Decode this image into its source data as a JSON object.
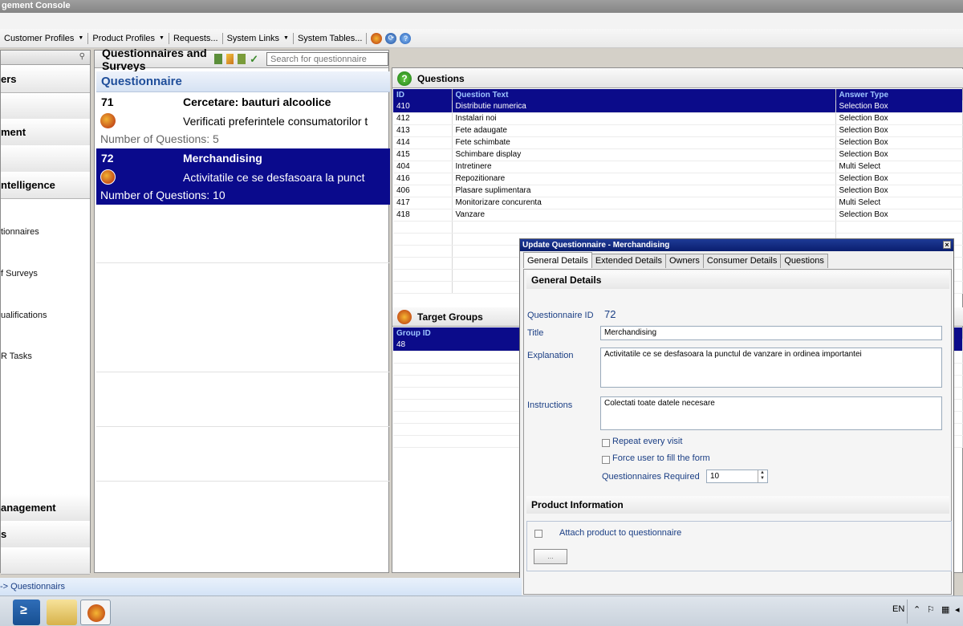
{
  "window": {
    "title": "gement Console"
  },
  "menu": {
    "items": [
      "Customer Profiles",
      "Product Profiles",
      "Requests...",
      "System Links",
      "System Tables..."
    ]
  },
  "left_nav": {
    "groups": [
      "ers",
      "ment",
      "ntelligence",
      "anagement",
      "s"
    ],
    "links": [
      "tionnaires",
      "f Surveys",
      "ualifications",
      "R Tasks"
    ]
  },
  "center": {
    "title": "Questionnaires and Surveys",
    "search_placeholder": "Search for questionnaire",
    "list_header": "Questionnaire",
    "items": [
      {
        "id": "71",
        "name": "Cercetare: bauturi alcoolice",
        "desc": "Verificati preferintele consumatorilor t",
        "count": "Number of Questions: 5"
      },
      {
        "id": "72",
        "name": "Merchandising",
        "desc": "Activitatile ce se desfasoara la punct",
        "count": "Number of Questions: 10"
      }
    ]
  },
  "questions": {
    "title": "Questions",
    "columns": [
      "ID",
      "Question Text",
      "Answer Type"
    ],
    "rows": [
      [
        "410",
        "Distributie numerica",
        "Selection Box"
      ],
      [
        "412",
        "Instalari noi",
        "Selection Box"
      ],
      [
        "413",
        "Fete adaugate",
        "Selection Box"
      ],
      [
        "414",
        "Fete schimbate",
        "Selection Box"
      ],
      [
        "415",
        "Schimbare display",
        "Selection Box"
      ],
      [
        "404",
        "Intretinere",
        "Multi Select"
      ],
      [
        "416",
        "Repozitionare",
        "Selection Box"
      ],
      [
        "406",
        "Plasare suplimentara",
        "Selection Box"
      ],
      [
        "417",
        "Monitorizare concurenta",
        "Multi Select"
      ],
      [
        "418",
        "Vanzare",
        "Selection Box"
      ]
    ]
  },
  "target_groups": {
    "title": "Target Groups",
    "columns": [
      "Group ID"
    ],
    "rows": [
      [
        "48"
      ]
    ]
  },
  "dialog": {
    "title": "Update Questionnaire - Merchandising",
    "close": "×",
    "tabs": [
      "General Details",
      "Extended Details",
      "Owners",
      "Consumer Details",
      "Questions"
    ],
    "section_general": "General Details",
    "id_label": "Questionnaire ID",
    "id_value": "72",
    "title_label": "Title",
    "title_value": "Merchandising",
    "explanation_label": "Explanation",
    "explanation_value": "Activitatile ce se desfasoara la punctul de vanzare in ordinea importantei",
    "instructions_label": "Instructions",
    "instructions_value": "Colectati toate datele necesare",
    "repeat_label": "Repeat every visit",
    "force_label": "Force user to fill the form",
    "required_label": "Questionnaires Required",
    "required_value": "10",
    "section_product": "Product Information",
    "attach_label": "Attach product to questionnaire",
    "browse_button": "..."
  },
  "status": {
    "path": "-> Questionnairs"
  },
  "taskbar": {
    "lang": "EN"
  }
}
